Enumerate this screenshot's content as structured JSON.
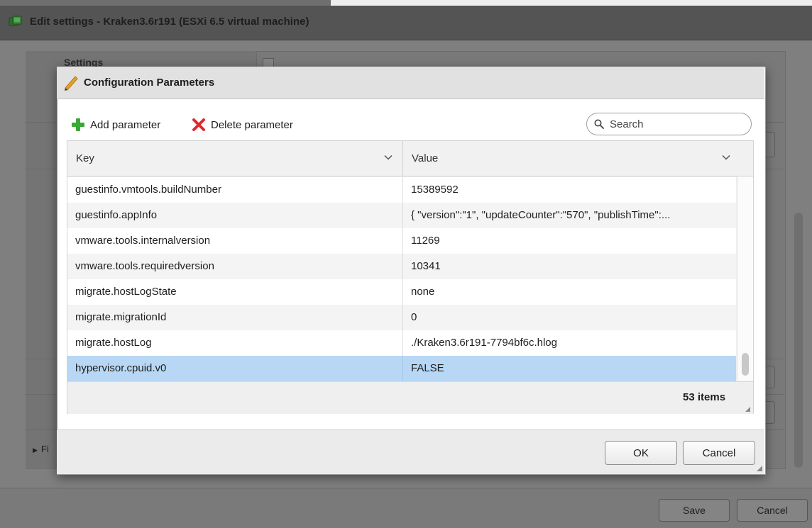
{
  "outer": {
    "title": "Edit settings - Kraken3.6r191 (ESXi 6.5 virtual machine)",
    "settings_label": "Settings",
    "collapsed_section_label": "Fi",
    "save_label": "Save",
    "cancel_label": "Cancel"
  },
  "modal": {
    "title": "Configuration Parameters",
    "toolbar": {
      "add_label": "Add parameter",
      "delete_label": "Delete parameter",
      "search_placeholder": "Search"
    },
    "columns": {
      "key": "Key",
      "value": "Value"
    },
    "rows": [
      {
        "key": "guestinfo.vmtools.buildNumber",
        "value": "15389592"
      },
      {
        "key": "guestinfo.appInfo",
        "value": "{ \"version\":\"1\", \"updateCounter\":\"570\", \"publishTime\":..."
      },
      {
        "key": "vmware.tools.internalversion",
        "value": "11269"
      },
      {
        "key": "vmware.tools.requiredversion",
        "value": "10341"
      },
      {
        "key": "migrate.hostLogState",
        "value": "none"
      },
      {
        "key": "migrate.migrationId",
        "value": "0"
      },
      {
        "key": "migrate.hostLog",
        "value": "./Kraken3.6r191-7794bf6c.hlog"
      },
      {
        "key": "hypervisor.cpuid.v0",
        "value": "FALSE",
        "selected": true
      }
    ],
    "items_count": "53 items",
    "ok_label": "OK",
    "cancel_label": "Cancel"
  },
  "icons": {
    "add": "plus-icon",
    "delete": "x-icon",
    "search": "search-icon",
    "title": "pencil-icon",
    "vm": "vm-icon",
    "column_menu": "chevron-down-icon"
  },
  "colors": {
    "add_green": "#3aa935",
    "delete_red": "#e3262a",
    "selection_blue": "#b7d7f4",
    "pencil_orange": "#e2a12c"
  }
}
